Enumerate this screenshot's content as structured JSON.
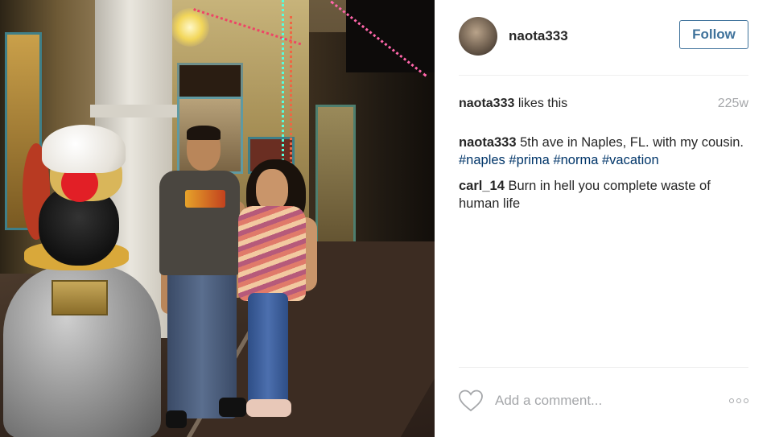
{
  "post": {
    "username": "naota333",
    "follow_label": "Follow",
    "likes": {
      "user": "naota333",
      "suffix": " likes this"
    },
    "timestamp": "225w",
    "comments": [
      {
        "user": "naota333",
        "text": " 5th ave in Naples, FL. with my cousin. ",
        "hashtags": [
          "#naples",
          "#prima",
          "#norma",
          "#vacation"
        ]
      },
      {
        "user": "carl_14",
        "text": " Burn in hell you complete waste of human life"
      }
    ],
    "add_comment_placeholder": "Add a comment...",
    "icons": {
      "like": "heart-icon",
      "more": "more-options-icon"
    },
    "colors": {
      "follow": "#3f729b",
      "hashtag": "#003569",
      "muted": "#a5a7aa"
    }
  }
}
